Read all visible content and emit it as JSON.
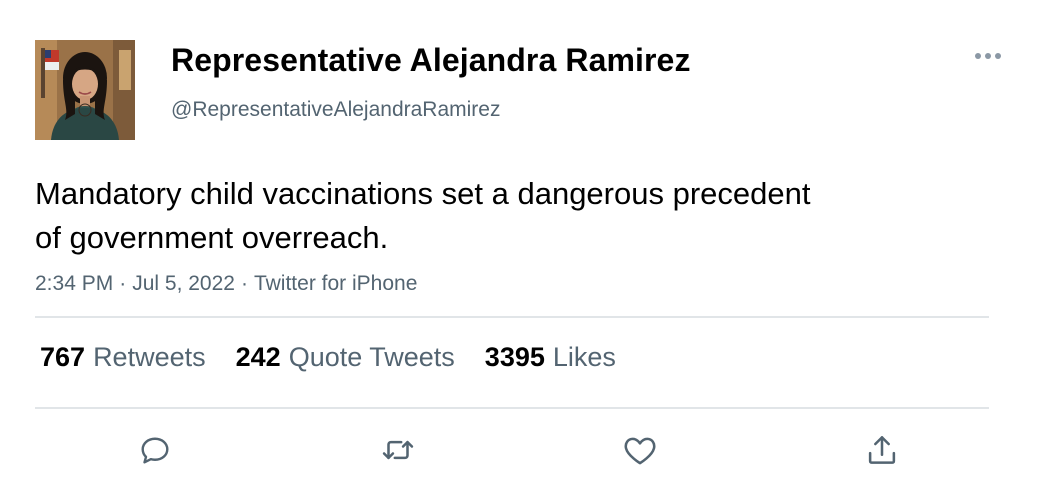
{
  "author": {
    "display_name": "Representative Alejandra Ramirez",
    "handle": "@RepresentativeAlejandraRamirez",
    "avatar_icon": "profile-photo"
  },
  "tweet": {
    "line1": "Mandatory child vaccinations set a dangerous precedent",
    "line2": "of government overreach."
  },
  "meta": {
    "time": "2:34 PM",
    "date": "Jul 5, 2022",
    "source": "Twitter for iPhone",
    "separator": "·"
  },
  "stats": {
    "retweets_count": "767",
    "retweets_label": "Retweets",
    "quotes_count": "242",
    "quotes_label": "Quote Tweets",
    "likes_count": "3395",
    "likes_label": "Likes"
  },
  "actions": {
    "icons": [
      "reply-icon",
      "retweet-icon",
      "like-icon",
      "share-icon"
    ]
  },
  "colors": {
    "text_primary": "#000000",
    "text_secondary": "#536471",
    "divider": "#e1e5e8",
    "icon": "#536471"
  }
}
